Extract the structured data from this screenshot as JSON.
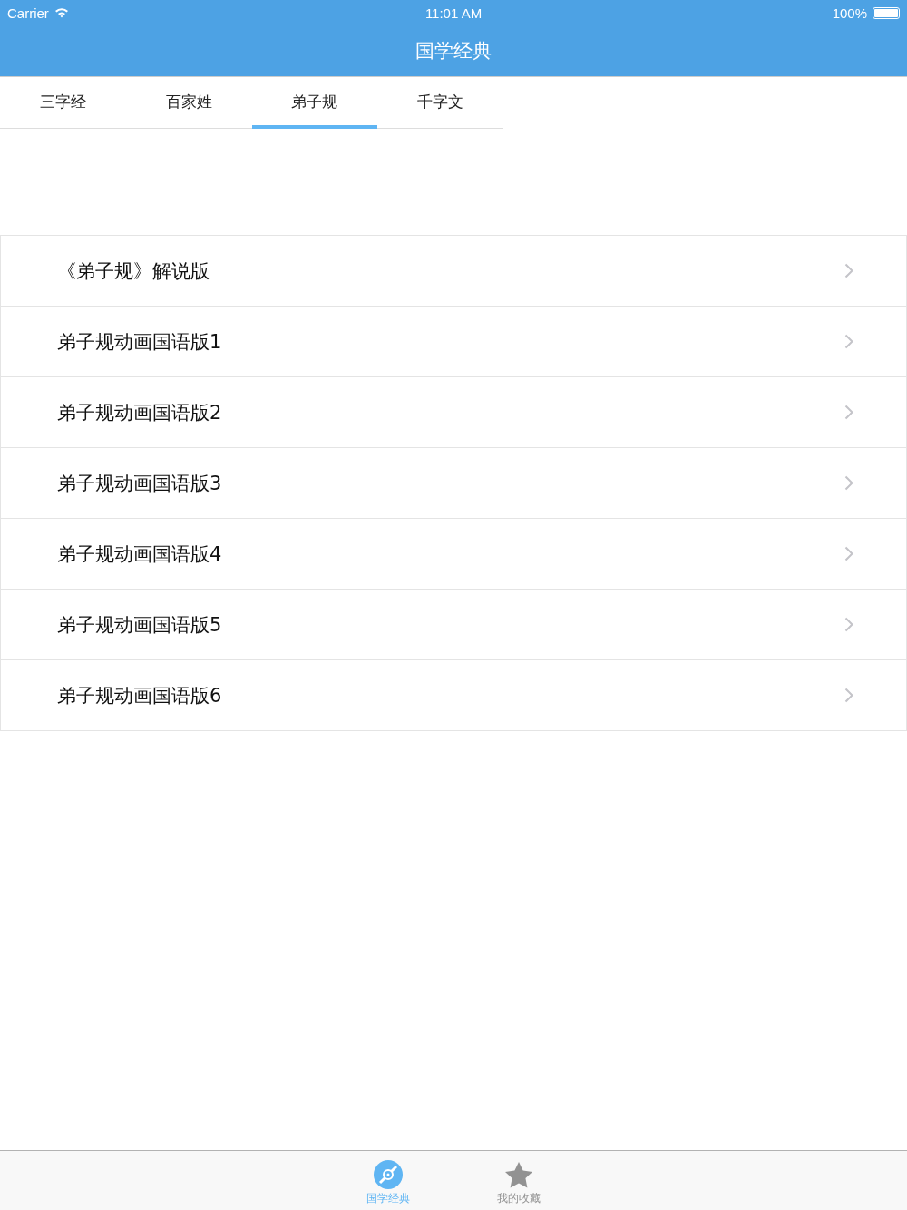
{
  "status_bar": {
    "carrier": "Carrier",
    "time": "11:01 AM",
    "battery": "100%"
  },
  "nav_bar": {
    "title": "国学经典"
  },
  "tabs": [
    {
      "label": "三字经",
      "selected": false
    },
    {
      "label": "百家姓",
      "selected": false
    },
    {
      "label": "弟子规",
      "selected": true
    },
    {
      "label": "千字文",
      "selected": false
    }
  ],
  "list": [
    {
      "title": "《弟子规》解说版"
    },
    {
      "title": "弟子规动画国语版1"
    },
    {
      "title": "弟子规动画国语版2"
    },
    {
      "title": "弟子规动画国语版3"
    },
    {
      "title": "弟子规动画国语版4"
    },
    {
      "title": "弟子规动画国语版5"
    },
    {
      "title": "弟子规动画国语版6"
    }
  ],
  "tab_bar": [
    {
      "label": "国学经典",
      "kind": "disc",
      "selected": true
    },
    {
      "label": "我的收藏",
      "kind": "star",
      "selected": false
    }
  ]
}
